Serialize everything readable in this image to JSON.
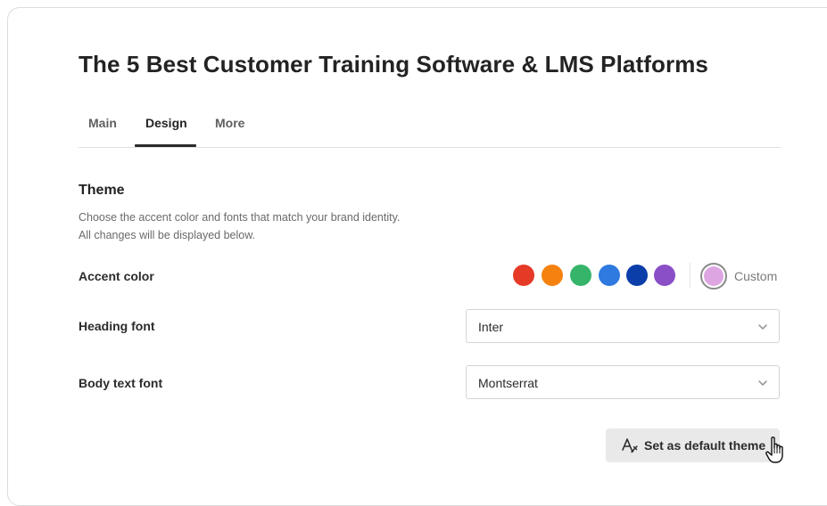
{
  "page": {
    "title": "The 5 Best Customer Training Software & LMS Platforms"
  },
  "tabs": [
    {
      "label": "Main",
      "active": false
    },
    {
      "label": "Design",
      "active": true
    },
    {
      "label": "More",
      "active": false
    }
  ],
  "theme": {
    "title": "Theme",
    "description_line1": "Choose the accent color and fonts that match your brand identity.",
    "description_line2": "All changes will be displayed below.",
    "accent_color": {
      "label": "Accent color",
      "swatches": [
        {
          "name": "red",
          "color": "#e53a26"
        },
        {
          "name": "orange",
          "color": "#f5820f"
        },
        {
          "name": "green",
          "color": "#36b56a"
        },
        {
          "name": "blue",
          "color": "#2e7ae0"
        },
        {
          "name": "dark-blue",
          "color": "#0b3ea8"
        },
        {
          "name": "purple",
          "color": "#8a4ec7"
        }
      ],
      "custom": {
        "label": "Custom",
        "color": "#dda6e3",
        "selected": true
      }
    },
    "heading_font": {
      "label": "Heading font",
      "value": "Inter",
      "icon": "chevron-down-icon"
    },
    "body_font": {
      "label": "Body text font",
      "value": "Montserrat",
      "icon": "chevron-down-icon"
    },
    "default_button": {
      "label": "Set as default theme",
      "icon": "font-style-icon"
    }
  },
  "colors": {
    "text_primary": "#232323",
    "text_secondary": "#6a6a6a",
    "button_bg": "#e9e9e9",
    "border": "#d4d4d4"
  }
}
